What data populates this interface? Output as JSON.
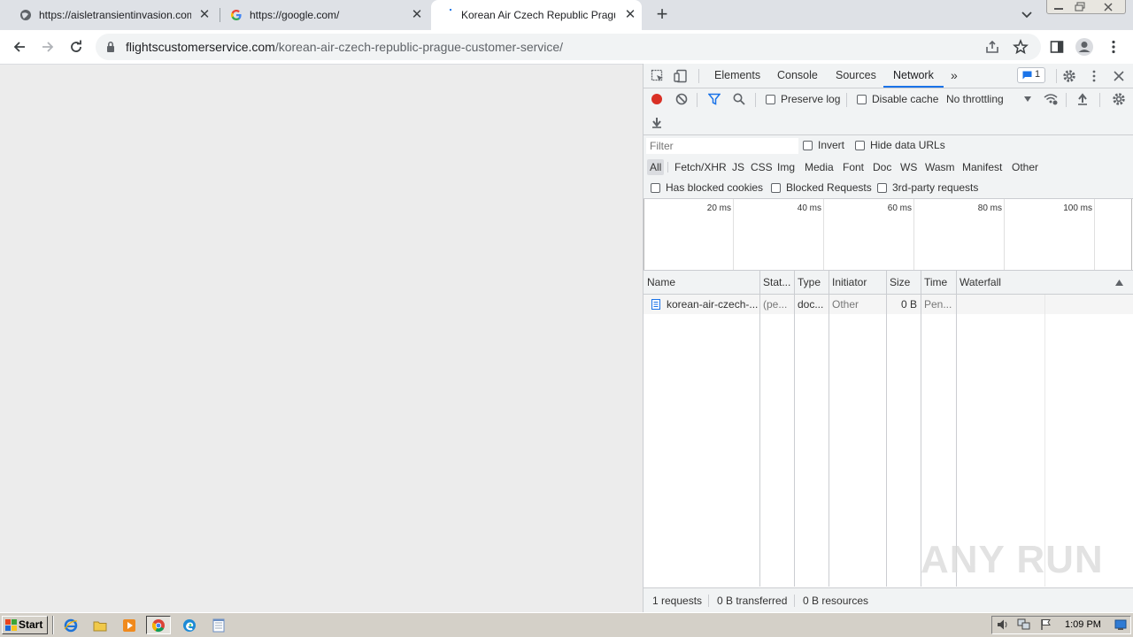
{
  "browser": {
    "tabs": [
      {
        "title": "https://aisletransientinvasion.com/d",
        "favicon": "globe-icon",
        "active": false
      },
      {
        "title": "https://google.com/",
        "favicon": "google-icon",
        "active": false
      },
      {
        "title": "Korean Air Czech Republic Prague C",
        "favicon": "loading-icon",
        "active": true
      }
    ],
    "new_tab_symbol": "+",
    "close_symbol": "✕",
    "url_domain": "flightscustomerservice.com",
    "url_path": "/korean-air-czech-republic-prague-customer-service/"
  },
  "devtools": {
    "tabs": [
      "Elements",
      "Console",
      "Sources",
      "Network"
    ],
    "active_tab": "Network",
    "more_tabs_symbol": "»",
    "issues_count": "1",
    "toolbar": {
      "preserve_log": "Preserve log",
      "disable_cache": "Disable cache",
      "throttling": "No throttling"
    },
    "filter": {
      "placeholder": "Filter",
      "invert": "Invert",
      "hide_data_urls": "Hide data URLs",
      "types": [
        "All",
        "Fetch/XHR",
        "JS",
        "CSS",
        "Img",
        "Media",
        "Font",
        "Doc",
        "WS",
        "Wasm",
        "Manifest",
        "Other"
      ],
      "active_type": "All",
      "has_blocked_cookies": "Has blocked cookies",
      "blocked_requests": "Blocked Requests",
      "third_party": "3rd-party requests"
    },
    "timeline_ticks": [
      "20 ms",
      "40 ms",
      "60 ms",
      "80 ms",
      "100 ms"
    ],
    "table": {
      "columns": [
        "Name",
        "Stat...",
        "Type",
        "Initiator",
        "Size",
        "Time",
        "Waterfall"
      ],
      "rows": [
        {
          "name": "korean-air-czech-...",
          "status": "(pe...",
          "type": "doc...",
          "initiator": "Other",
          "size": "0 B",
          "time": "Pen..."
        }
      ]
    },
    "status": {
      "requests": "1 requests",
      "transferred": "0 B transferred",
      "resources": "0 B resources"
    }
  },
  "watermark": "ANY RUN",
  "taskbar": {
    "start_label": "Start",
    "clock": "1:09 PM"
  },
  "colors": {
    "accent": "#1a73e8",
    "record_red": "#d93025",
    "tabstrip": "#dee1e6",
    "taskbar": "#d4d0c8"
  }
}
